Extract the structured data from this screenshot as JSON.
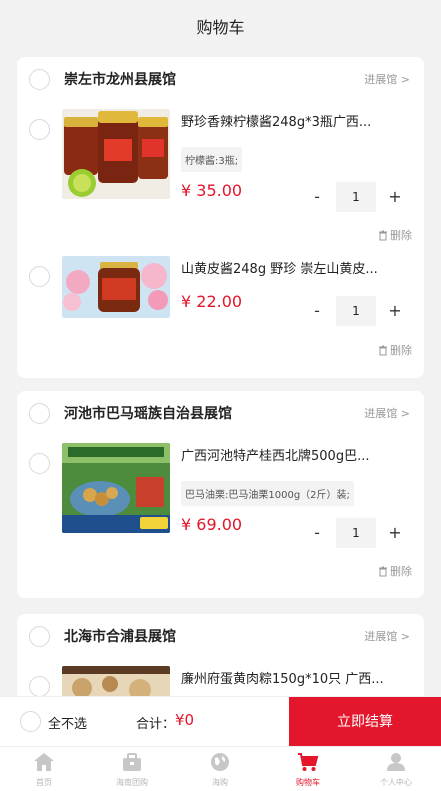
{
  "header": {
    "title": "购物车"
  },
  "stores": [
    {
      "name": "崇左市龙州县展馆",
      "enter_label": "进展馆 >",
      "items": [
        {
          "title": "野珍香辣柠檬酱248g*3瓶广西...",
          "spec": "柠檬酱:3瓶;",
          "price": "¥ 35.00",
          "qty": "1",
          "delete_label": "删除"
        },
        {
          "title": "山黄皮酱248g 野珍 崇左山黄皮...",
          "spec": "",
          "price": "¥ 22.00",
          "qty": "1",
          "delete_label": "删除"
        }
      ]
    },
    {
      "name": "河池市巴马瑶族自治县展馆",
      "enter_label": "进展馆 >",
      "items": [
        {
          "title": "广西河池特产桂西北牌500g巴...",
          "spec": "巴马油栗:巴马油栗1000g（2斤）装;",
          "price": "¥ 69.00",
          "qty": "1",
          "delete_label": "删除"
        }
      ]
    },
    {
      "name": "北海市合浦县展馆",
      "enter_label": "进展馆 >",
      "items": [
        {
          "title": "廉州府蛋黄肉粽150g*10只 广西..."
        }
      ]
    }
  ],
  "stepper": {
    "minus": "-",
    "plus": "+"
  },
  "footer": {
    "select_all": "全不选",
    "total_label": "合计：",
    "total_value": "¥0",
    "checkout": "立即结算"
  },
  "tabs": [
    {
      "label": "首页",
      "icon": "home-icon"
    },
    {
      "label": "海南团购",
      "icon": "briefcase-icon"
    },
    {
      "label": "海购",
      "icon": "globe-icon"
    },
    {
      "label": "购物车",
      "icon": "cart-icon",
      "active": true
    },
    {
      "label": "个人中心",
      "icon": "user-icon"
    }
  ],
  "colors": {
    "accent": "#e3162b",
    "background": "#f2f2f2",
    "muted": "#999999"
  }
}
